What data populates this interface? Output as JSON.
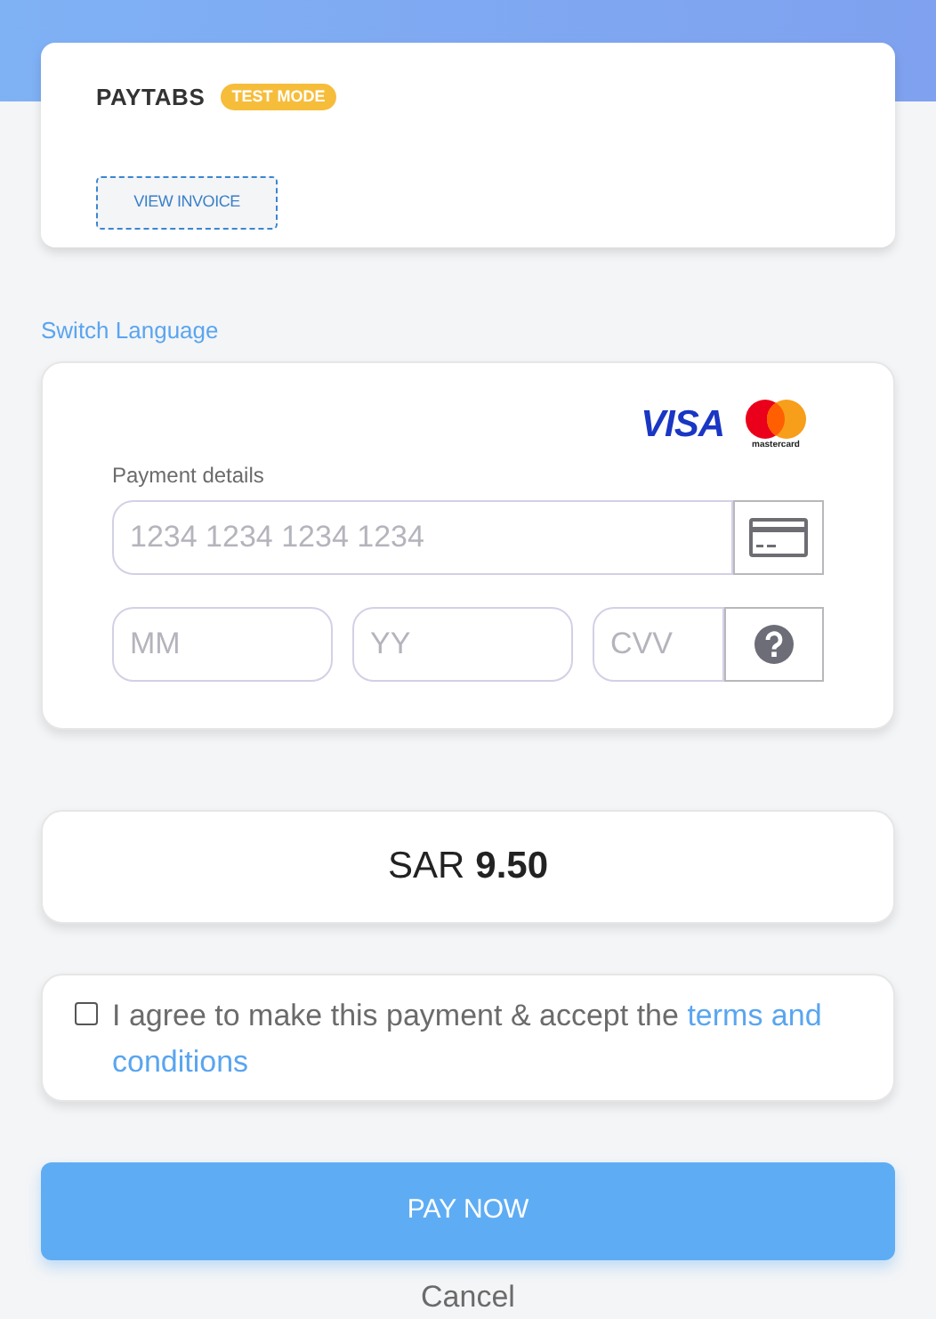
{
  "merchant": {
    "name": "PAYTABS",
    "badge": "TEST MODE",
    "invoice_button": "VIEW INVOICE"
  },
  "switch_language": "Switch Language",
  "card_brands": [
    "VISA",
    "mastercard"
  ],
  "payment": {
    "label": "Payment details",
    "card_number": {
      "placeholder": "1234 1234 1234 1234"
    },
    "month": {
      "placeholder": "MM"
    },
    "year": {
      "placeholder": "YY"
    },
    "cvv": {
      "placeholder": "CVV"
    }
  },
  "amount": {
    "currency": "SAR",
    "value": "9.50"
  },
  "agreement": {
    "checked": false,
    "text": "I agree to make this payment & accept the ",
    "link_lines": [
      "terms and",
      "conditions"
    ]
  },
  "pay_button": "PAY NOW",
  "cancel": "Cancel"
}
